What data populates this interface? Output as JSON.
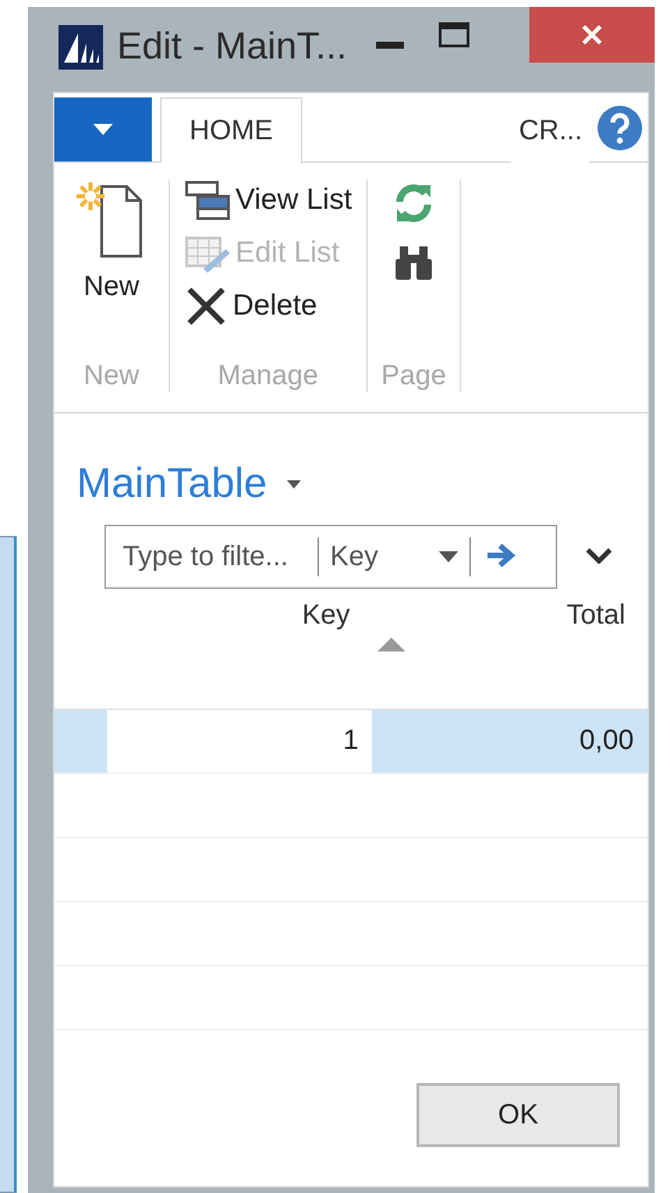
{
  "window": {
    "title": "Edit - MainT..."
  },
  "ribbon": {
    "tabs": [
      {
        "label": "HOME",
        "selected": true
      },
      {
        "label": "CR...",
        "selected": false
      }
    ],
    "groups": [
      {
        "label": "New",
        "items": [
          {
            "kind": "large",
            "label": "New",
            "disabled": false
          }
        ]
      },
      {
        "label": "Manage",
        "items": [
          {
            "kind": "small",
            "label": "View List",
            "disabled": false
          },
          {
            "kind": "small",
            "label": "Edit List",
            "disabled": true
          },
          {
            "kind": "small",
            "label": "Delete",
            "disabled": false
          }
        ]
      },
      {
        "label": "Page",
        "items": [
          {
            "kind": "icon",
            "disabled": false
          },
          {
            "kind": "icon",
            "disabled": false
          }
        ]
      }
    ]
  },
  "page": {
    "title": "MainTable",
    "filter": {
      "placeholder": "Type to filte...",
      "field": "Key"
    },
    "table": {
      "columns": [
        {
          "label": "Key",
          "sorted": true
        },
        {
          "label": "Total",
          "sorted": false
        }
      ],
      "rows": [
        {
          "selected": true,
          "cells": [
            {
              "text": "1",
              "focused": true
            },
            {
              "text": "0,00",
              "focused": false
            }
          ]
        }
      ]
    }
  },
  "buttons": [
    "OK"
  ]
}
